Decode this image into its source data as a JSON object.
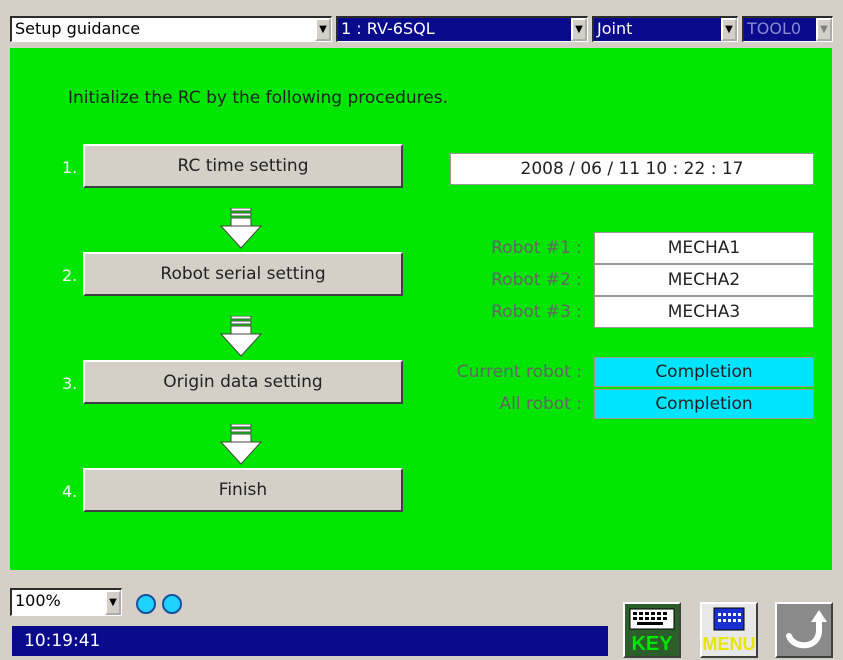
{
  "toolbar": {
    "mode_select": "Setup guidance",
    "robot_select": "1 : RV-6SQL",
    "coord_select": "Joint",
    "tool_select": "TOOL0"
  },
  "colors": {
    "panel_bg": "#00e600",
    "selected_bg": "#0a0a8c",
    "status_cyan": "#00e5ff"
  },
  "main": {
    "instruction": "Initialize the RC by the following procedures.",
    "steps": [
      {
        "num": "1.",
        "label": "RC time setting"
      },
      {
        "num": "2.",
        "label": "Robot serial setting"
      },
      {
        "num": "3.",
        "label": "Origin data setting"
      },
      {
        "num": "4.",
        "label": "Finish"
      }
    ],
    "datetime": "2008 / 06 / 11   10 : 22 : 17",
    "robots": [
      {
        "label": "Robot #1 :",
        "value": "MECHA1"
      },
      {
        "label": "Robot #2 :",
        "value": "MECHA2"
      },
      {
        "label": "Robot #3 :",
        "value": "MECHA3"
      }
    ],
    "status": [
      {
        "label": "Current robot :",
        "value": "Completion"
      },
      {
        "label": "All robot :",
        "value": "Completion"
      }
    ]
  },
  "bottom": {
    "zoom": "100%",
    "time": "10:19:41",
    "key_label": "KEY",
    "menu_label": "MENU",
    "icons": [
      "keyboard-icon",
      "menu-icon",
      "back-arrow-icon"
    ]
  }
}
